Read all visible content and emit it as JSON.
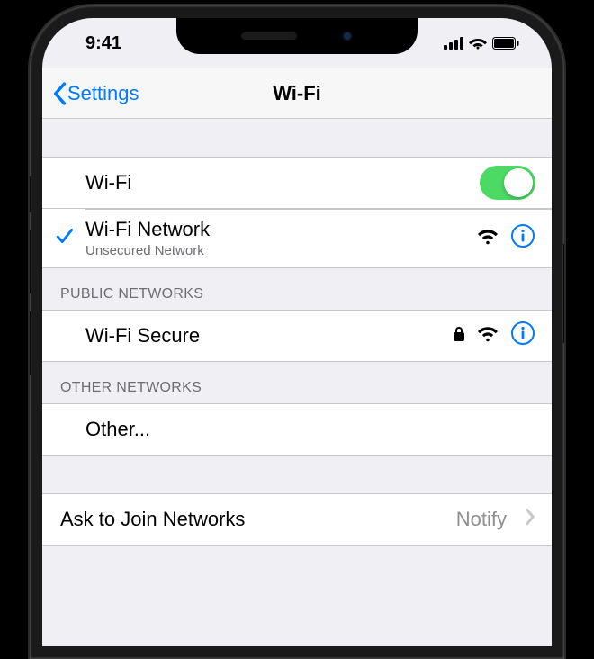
{
  "status": {
    "time": "9:41"
  },
  "nav": {
    "back": "Settings",
    "title": "Wi-Fi"
  },
  "wifi_toggle": {
    "label": "Wi-Fi",
    "on": true
  },
  "connected": {
    "name": "Wi-Fi Network",
    "subtitle": "Unsecured Network"
  },
  "sections": {
    "public": {
      "header": "PUBLIC NETWORKS"
    },
    "other_networks": {
      "header": "OTHER NETWORKS"
    }
  },
  "public_network": {
    "name": "Wi-Fi Secure"
  },
  "other_row": {
    "label": "Other..."
  },
  "ask": {
    "label": "Ask to Join Networks",
    "value": "Notify"
  }
}
